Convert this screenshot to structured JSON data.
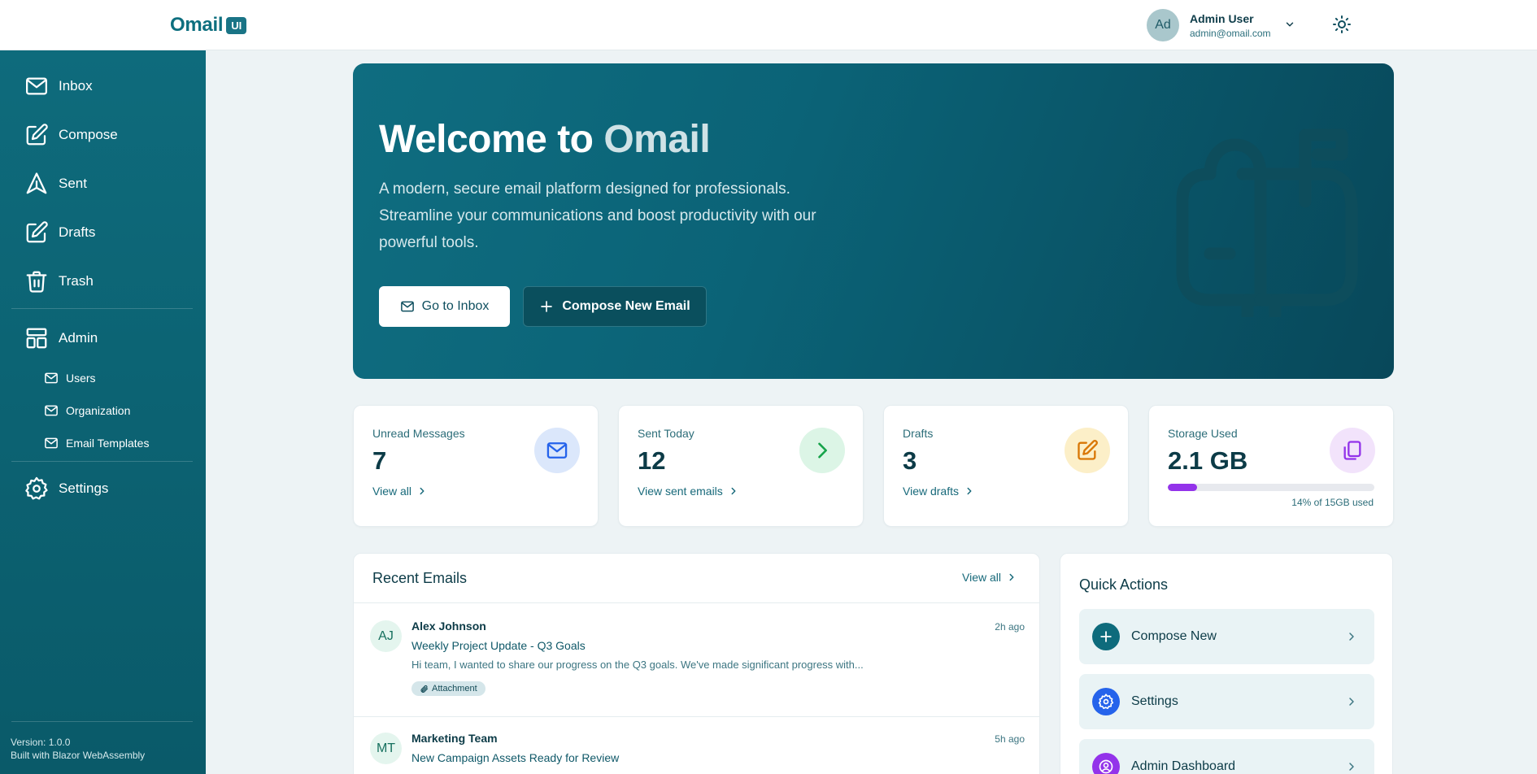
{
  "brand": {
    "name": "Omail",
    "badge": "UI"
  },
  "user": {
    "initials": "Ad",
    "name": "Admin User",
    "email": "admin@omail.com"
  },
  "sidebar": {
    "items": [
      {
        "label": "Inbox",
        "icon": "mail-icon"
      },
      {
        "label": "Compose",
        "icon": "edit-icon"
      },
      {
        "label": "Sent",
        "icon": "send-icon"
      },
      {
        "label": "Drafts",
        "icon": "edit-icon"
      },
      {
        "label": "Trash",
        "icon": "trash-icon"
      }
    ],
    "admin": {
      "label": "Admin",
      "icon": "layout-icon"
    },
    "admin_items": [
      {
        "label": "Users",
        "icon": "mail-icon"
      },
      {
        "label": "Organization",
        "icon": "mail-icon"
      },
      {
        "label": "Email Templates",
        "icon": "mail-icon"
      }
    ],
    "settings": {
      "label": "Settings",
      "icon": "gear-icon"
    },
    "version": "Version: 1.0.0",
    "built_with": "Built with Blazor WebAssembly"
  },
  "hero": {
    "title_prefix": "Welcome to",
    "title_accent": "Omail",
    "description": "A modern, secure email platform designed for professionals. Streamline your communications and boost productivity with our powerful tools.",
    "primary_button": "Go to Inbox",
    "secondary_button": "Compose New Email"
  },
  "stats": [
    {
      "label": "Unread Messages",
      "value": "7",
      "link": "View all",
      "icon": "mail-icon",
      "icon_color": "#2563eb",
      "icon_bg": "#dbe7fb"
    },
    {
      "label": "Sent Today",
      "value": "12",
      "link": "View sent emails",
      "icon": "chevron-right-icon",
      "icon_color": "#16a34a",
      "icon_bg": "#dcf5e6"
    },
    {
      "label": "Drafts",
      "value": "3",
      "link": "View drafts",
      "icon": "edit-icon",
      "icon_color": "#d97706",
      "icon_bg": "#fcefc8"
    },
    {
      "label": "Storage Used",
      "value": "2.1 GB",
      "note": "14% of 15GB used",
      "progress": 0.14,
      "icon": "copy-icon",
      "icon_color": "#9333ea",
      "icon_bg": "#f2e3fb"
    }
  ],
  "recent": {
    "title": "Recent Emails",
    "view_all": "View all",
    "emails": [
      {
        "initials": "AJ",
        "sender": "Alex Johnson",
        "subject": "Weekly Project Update - Q3 Goals",
        "preview": "Hi team, I wanted to share our progress on the Q3 goals. We've made significant progress with...",
        "time": "2h ago",
        "tag": "Attachment"
      },
      {
        "initials": "MT",
        "sender": "Marketing Team",
        "subject": "New Campaign Assets Ready for Review",
        "preview": "",
        "time": "5h ago",
        "tag": ""
      }
    ]
  },
  "quick_actions": {
    "title": "Quick Actions",
    "items": [
      {
        "label": "Compose New",
        "icon": "plus-icon",
        "icon_bg": "#0e6b7c"
      },
      {
        "label": "Settings",
        "icon": "gear-icon",
        "icon_bg": "#2563eb"
      },
      {
        "label": "Admin Dashboard",
        "icon": "user-circle-icon",
        "icon_bg": "#9333ea"
      }
    ]
  },
  "colors": {
    "primary": "#0e6b7c",
    "sidebar": "#0a5a69",
    "background": "#edf3f5",
    "storage": "#9333ea"
  }
}
